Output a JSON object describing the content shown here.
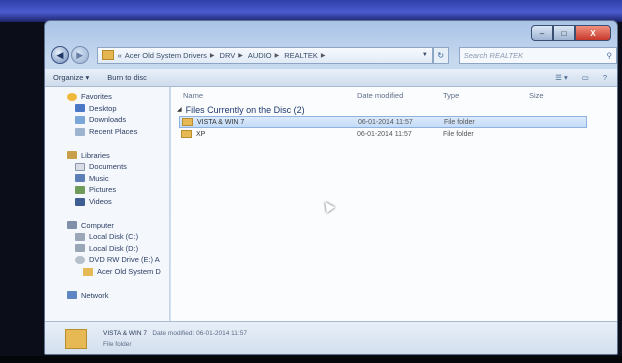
{
  "window": {
    "caption_buttons": {
      "minimize": "–",
      "maximize": "□",
      "close": "X"
    }
  },
  "address_bar": {
    "back_glyph": "◀",
    "forward_glyph": "▶",
    "overflow": "«",
    "crumbs": [
      "Acer Old System Drivers",
      "DRV",
      "AUDIO",
      "REALTEK"
    ],
    "refresh_glyph": "↻",
    "search_placeholder": "Search REALTEK"
  },
  "toolbar": {
    "organize": "Organize ▾",
    "burn": "Burn to disc",
    "views": "☰ ▾",
    "preview": "▭",
    "help": "?"
  },
  "nav_pane": {
    "favorites": "Favorites",
    "favorites_items": [
      "Desktop",
      "Downloads",
      "Recent Places"
    ],
    "libraries": "Libraries",
    "libraries_items": [
      "Documents",
      "Music",
      "Pictures",
      "Videos"
    ],
    "computer": "Computer",
    "computer_items": [
      "Local Disk (C:)",
      "Local Disk (D:)",
      "DVD RW Drive (E:) A"
    ],
    "computer_subitem": "Acer Old System D",
    "network": "Network"
  },
  "content": {
    "columns": {
      "name": "Name",
      "date": "Date modified",
      "type": "Type",
      "size": "Size"
    },
    "group_title": "Files Currently on the Disc (2)",
    "files": [
      {
        "name": "VISTA & WIN 7",
        "date": "06-01-2014 11:57",
        "type": "File folder",
        "selected": true
      },
      {
        "name": "XP",
        "date": "06-01-2014 11:57",
        "type": "File folder",
        "selected": false
      }
    ]
  },
  "details_pane": {
    "name": "VISTA & WIN 7",
    "date_label": "Date modified:",
    "date_value": "06-01-2014 11:57",
    "type": "File folder"
  },
  "colors": {
    "folder": "#e6b955",
    "selection": "#c3dbf7",
    "link_text": "#2c3f66"
  }
}
